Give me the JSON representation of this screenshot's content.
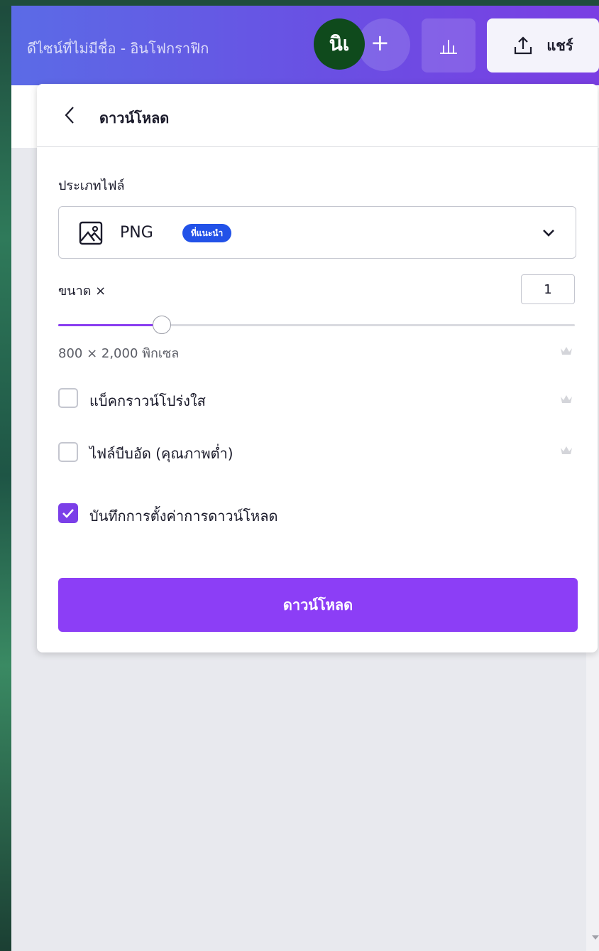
{
  "header": {
    "doc_title": "ดีไซน์ที่ไม่มีชื่อ - อินโฟกราฟิก",
    "avatar_text": "นิเ",
    "add_symbol": "+",
    "share_label": "แชร์"
  },
  "panel": {
    "title": "ดาวน์โหลด",
    "file_type_label": "ประเภทไฟล์",
    "file_type_value": "PNG",
    "recommended_badge": "ที่แนะนำ",
    "size_label": "ขนาด ×",
    "size_value": "1",
    "size_slider_fraction": 0.2,
    "dimensions_text": "800 × 2,000 พิกเซล",
    "options": [
      {
        "label": "แบ็คกราวน์โปร่งใส",
        "checked": false,
        "premium": true
      },
      {
        "label": "ไฟล์บีบอัด (คุณภาพต่ำ)",
        "checked": false,
        "premium": true
      },
      {
        "label": "บันทึกการตั้งค่าการดาวน์โหลด",
        "checked": true,
        "premium": false
      }
    ],
    "download_button": "ดาวน์โหลด"
  },
  "colors": {
    "accent": "#8c3ef6",
    "badge": "#2252e8",
    "avatar": "#0f4a1c"
  },
  "icons": [
    "back-arrow-icon",
    "image-icon",
    "chevron-down-icon",
    "crown-icon",
    "upload-icon",
    "bar-chart-icon",
    "check-icon"
  ]
}
